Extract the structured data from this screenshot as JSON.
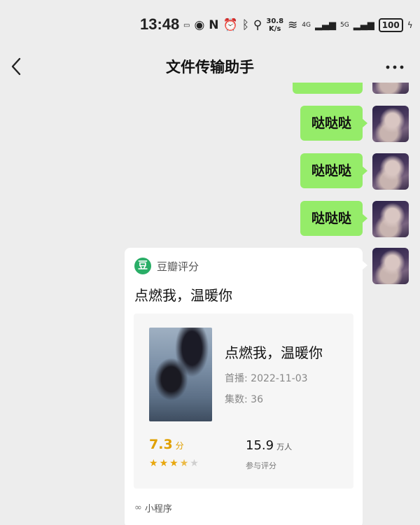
{
  "status_bar": {
    "time": "13:48",
    "net_speed_value": "30.8",
    "net_speed_unit": "K/s",
    "signal_1": "4G",
    "signal_2": "5G",
    "battery": "100"
  },
  "nav": {
    "title": "文件传输助手"
  },
  "messages": [
    {
      "text": "哒哒哒"
    },
    {
      "text": "哒哒哒"
    },
    {
      "text": "哒哒哒"
    }
  ],
  "card": {
    "source": "豆瓣评分",
    "logo_char": "豆",
    "title": "点燃我，温暖你",
    "show_title": "点燃我，温暖你",
    "premiere": "首播: 2022-11-03",
    "episodes": "集数: 36",
    "score": "7.3",
    "score_unit": "分",
    "stars": 3.5,
    "rating_count": "15.9",
    "rating_count_unit": "万人",
    "rating_count_label": "参与评分",
    "footer": "小程序"
  },
  "colors": {
    "bubble": "#95ec69",
    "background": "#ededed",
    "douban_green": "#2aae67",
    "score": "#e0a000"
  }
}
